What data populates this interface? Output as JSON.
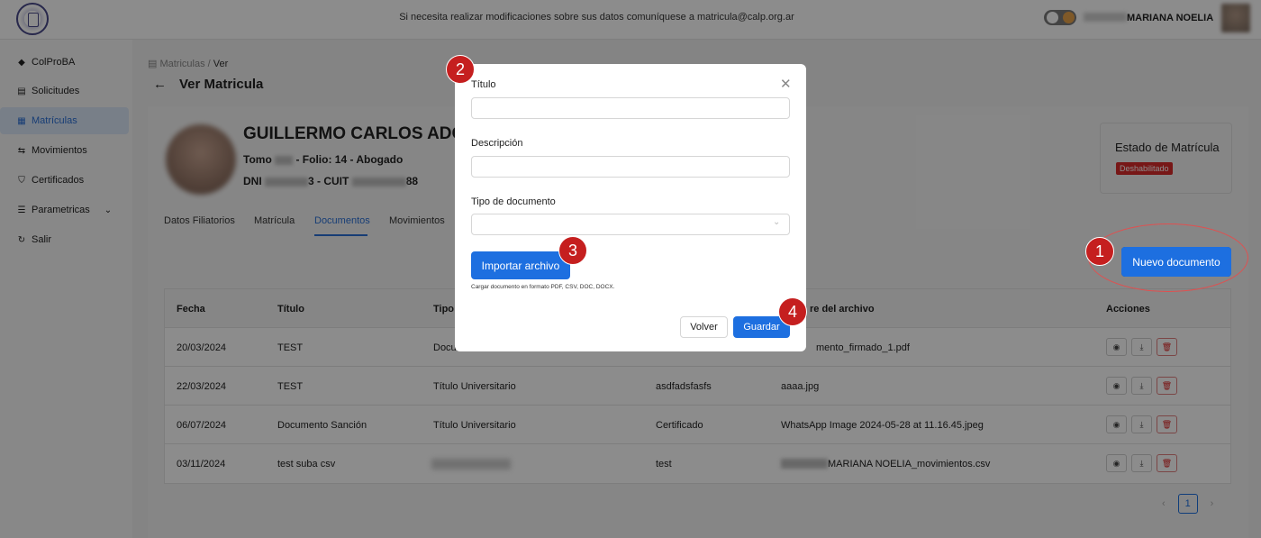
{
  "header": {
    "notice": "Si necesita realizar modificaciones sobre sus datos comuníquese a matricula@calp.org.ar",
    "username": "MARIANA NOELIA"
  },
  "sidebar": {
    "items": [
      {
        "label": "ColProBA",
        "icon": "bookmark-icon"
      },
      {
        "label": "Solicitudes",
        "icon": "document-icon"
      },
      {
        "label": "Matrículas",
        "icon": "registry-icon"
      },
      {
        "label": "Movimientos",
        "icon": "swap-icon"
      },
      {
        "label": "Certificados",
        "icon": "shield-icon"
      },
      {
        "label": "Parametricas",
        "icon": "list-icon"
      },
      {
        "label": "Salir",
        "icon": "logout-icon"
      }
    ],
    "active_index": 2
  },
  "breadcrumb": {
    "parent": "Matriculas",
    "separator": "/",
    "current": "Ver"
  },
  "page_title": "Ver Matricula",
  "profile": {
    "name": "GUILLERMO CARLOS ADO",
    "tomo_prefix": "Tomo",
    "tomo_suffix": "- Folio: 14 - Abogado",
    "dni_prefix": "DNI",
    "dni_mid": "3 - CUIT",
    "dni_suffix": "88"
  },
  "tabs": [
    "Datos Filiatorios",
    "Matrícula",
    "Documentos",
    "Movimientos"
  ],
  "active_tab": 2,
  "estado": {
    "label": "Estado de Matrícula",
    "badge": "Deshabilitado",
    "badge_color": "#d92b2b"
  },
  "nuevo_documento_label": "Nuevo documento",
  "table": {
    "headers": [
      "Fecha",
      "Título",
      "Tipo",
      "",
      "Nombre del archivo",
      "Acciones"
    ],
    "header_partial": {
      "tipo": "Tipo",
      "nombre": "re del archivo"
    },
    "rows": [
      {
        "fecha": "20/03/2024",
        "titulo": "TEST",
        "tipo": "Docu",
        "descripcion": "",
        "archivo": "mento_firmado_1.pdf"
      },
      {
        "fecha": "22/03/2024",
        "titulo": "TEST",
        "tipo": "Título Universitario",
        "descripcion": "asdfadsfasfs",
        "archivo": "aaaa.jpg"
      },
      {
        "fecha": "06/07/2024",
        "titulo": "Documento Sanción",
        "tipo": "Título Universitario",
        "descripcion": "Certificado",
        "archivo": "WhatsApp Image 2024-05-28 at 11.16.45.jpeg"
      },
      {
        "fecha": "03/11/2024",
        "titulo": "test suba csv",
        "tipo": "",
        "descripcion": "test",
        "archivo": "MARIANA NOELIA_movimientos.csv"
      }
    ]
  },
  "pager": {
    "current": "1",
    "prev": "‹",
    "next": "›"
  },
  "modal": {
    "titulo_label": "Título",
    "descripcion_label": "Descripción",
    "tipo_label": "Tipo de documento",
    "import_label": "Importar archivo",
    "import_hint": "Cargar documento en formato PDF, CSV, DOC, DOCX.",
    "volver_label": "Volver",
    "guardar_label": "Guardar"
  },
  "markers": [
    "1",
    "2",
    "3",
    "4"
  ],
  "colors": {
    "accent": "#1d6fe0",
    "marker": "#c51f1f",
    "danger": "#d92b2b"
  }
}
